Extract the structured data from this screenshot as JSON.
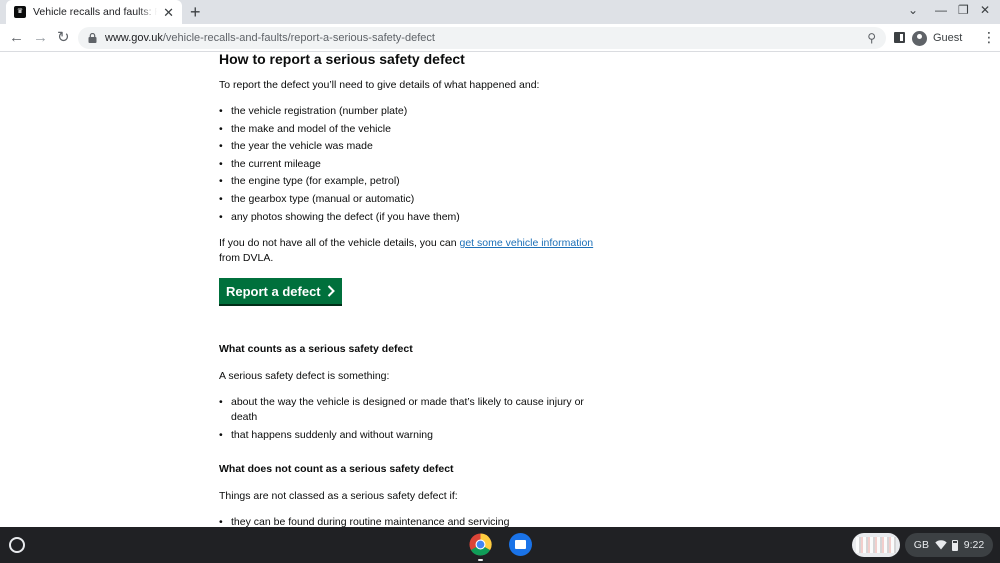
{
  "browser": {
    "tab_title": "Vehicle recalls and faults: Report a serious safety defect",
    "tab_close": "✕",
    "new_tab": "+",
    "url_host": "www.gov.uk",
    "url_path": "/vehicle-recalls-and-faults/report-a-serious-safety-defect",
    "profile_label": "Guest"
  },
  "page": {
    "heading": "How to report a serious safety defect",
    "intro": "To report the defect you’ll need to give details of what happened and:",
    "details_list": [
      "the vehicle registration (number plate)",
      "the make and model of the vehicle",
      "the year the vehicle was made",
      "the current mileage",
      "the engine type (for example, petrol)",
      "the gearbox type (manual or automatic)",
      "any photos showing the defect (if you have them)"
    ],
    "info_prefix": "If you do not have all of the vehicle details, you can ",
    "info_link": "get some vehicle information",
    "info_suffix": " from DVLA.",
    "start_button": "Report a defect",
    "counts_heading": "What counts as a serious safety defect",
    "counts_intro": "A serious safety defect is something:",
    "counts_list": [
      "about the way the vehicle is designed or made that’s likely to cause injury or death",
      "that happens suddenly and without warning"
    ],
    "not_counts_heading": "What does not count as a serious safety defect",
    "not_counts_intro": "Things are not classed as a serious safety defect if:",
    "not_counts_list": [
      "they can be found during routine maintenance and servicing"
    ]
  },
  "shelf": {
    "keyboard_layout": "GB",
    "time": "9:22"
  },
  "colors": {
    "govuk_green": "#00703c",
    "link_blue": "#1d70b8",
    "text": "#0b0c0c"
  }
}
